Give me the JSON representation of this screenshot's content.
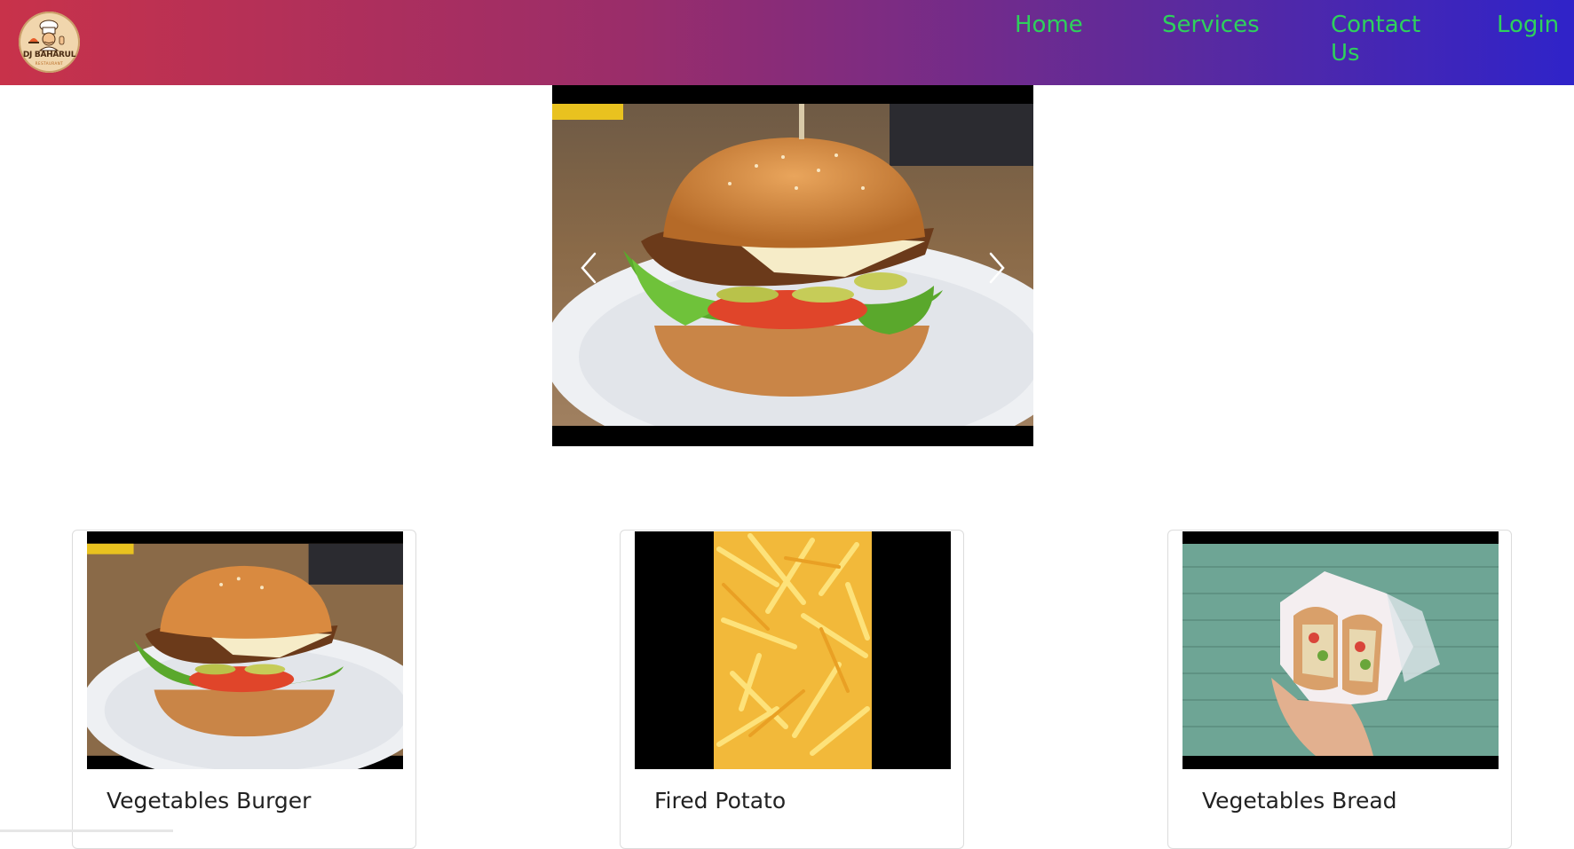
{
  "brand": {
    "logo_text": "DJ BAHARUL",
    "logo_subtext": "RESTAURANT",
    "logo_icon": "chef-icon"
  },
  "nav": {
    "links": [
      {
        "label": "Home"
      },
      {
        "label": "Services"
      },
      {
        "label": "Contact Us"
      },
      {
        "label": "Login"
      }
    ]
  },
  "carousel": {
    "slide_image": "burger-photo",
    "prev_icon": "chevron-left-icon",
    "next_icon": "chevron-right-icon"
  },
  "cards": [
    {
      "title": "Vegetables Burger",
      "image": "burger-photo"
    },
    {
      "title": "Fired Potato",
      "image": "fries-photo"
    },
    {
      "title": "Vegetables Bread",
      "image": "wrap-photo"
    }
  ],
  "colors": {
    "nav_gradient_start": "#c8324a",
    "nav_gradient_end": "#2f23c9",
    "nav_link": "#2ed15c"
  }
}
